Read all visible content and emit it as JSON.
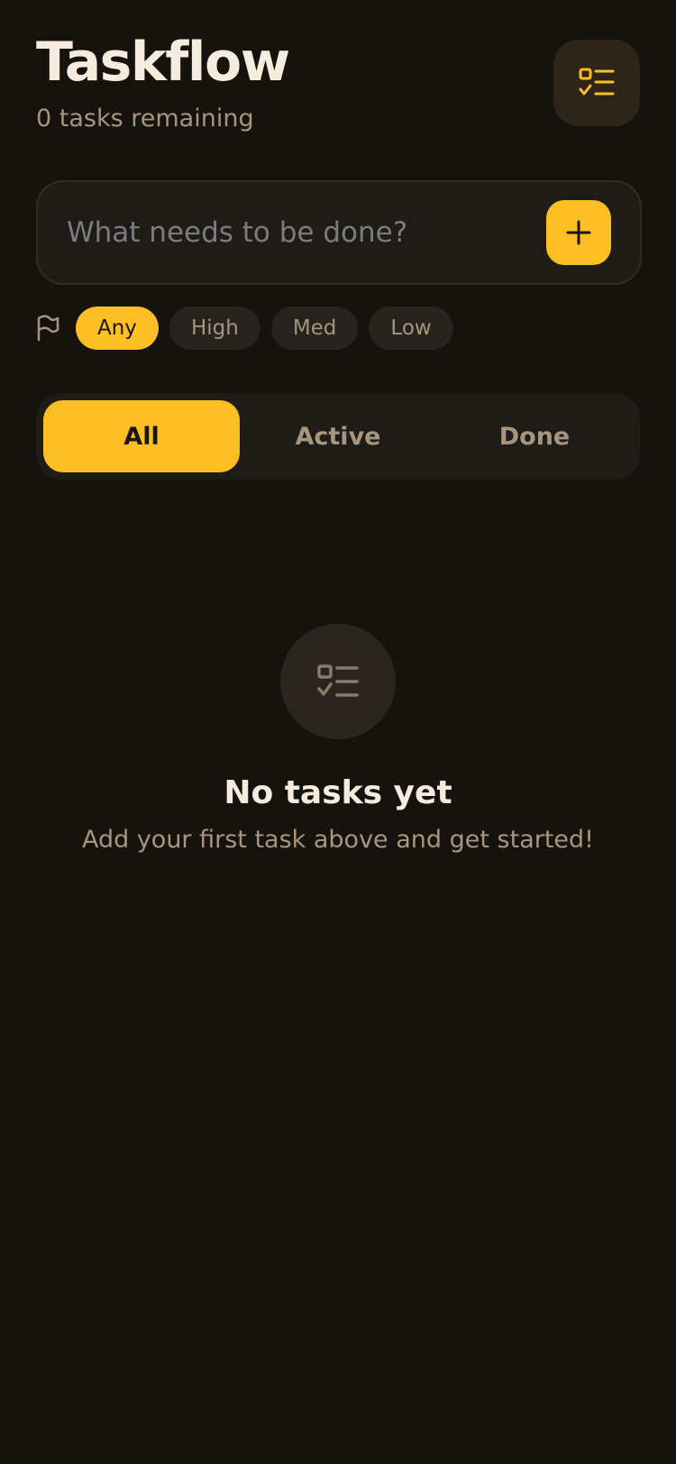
{
  "header": {
    "title": "Taskflow",
    "remaining_count": "0",
    "remaining_text": "0 tasks remaining",
    "menu_icon": "checklist-icon"
  },
  "new_task": {
    "placeholder": "What needs to be done?",
    "value": "",
    "add_icon": "plus-icon"
  },
  "priority_filter": {
    "icon": "flag-icon",
    "options": [
      "Any",
      "High",
      "Med",
      "Low"
    ],
    "selected": "Any"
  },
  "status_tabs": {
    "items": [
      "All",
      "Active",
      "Done"
    ],
    "selected": "All"
  },
  "empty_state": {
    "icon": "checklist-icon",
    "title": "No tasks yet",
    "message": "Add your first task above and get started!"
  },
  "colors": {
    "background": "#16130f",
    "surface": "#1f1b17",
    "accent": "#fbbf24",
    "text_primary": "#f5ecdd",
    "text_muted": "#a8957e"
  }
}
